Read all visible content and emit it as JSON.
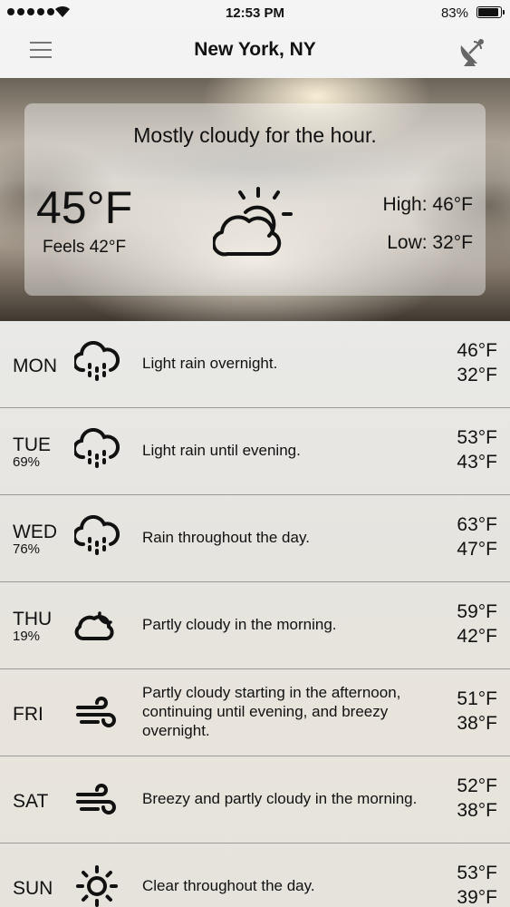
{
  "status_bar": {
    "time": "12:53 PM",
    "battery_pct": "83%",
    "battery_level": 0.83
  },
  "header": {
    "title": "New York, NY",
    "menu_icon": "hamburger-menu-icon",
    "radar_icon": "radar-dish-icon"
  },
  "current": {
    "summary": "Mostly cloudy for the hour.",
    "temp": "45°F",
    "feels_like": "Feels 42°F",
    "high": "High: 46°F",
    "low": "Low: 32°F",
    "icon": "partly-cloudy-day-icon"
  },
  "forecast": [
    {
      "day": "MON",
      "precip": "",
      "icon": "rain-icon",
      "desc": "Light rain overnight.",
      "high": "46°F",
      "low": "32°F"
    },
    {
      "day": "TUE",
      "precip": "69%",
      "icon": "rain-icon",
      "desc": "Light rain until evening.",
      "high": "53°F",
      "low": "43°F"
    },
    {
      "day": "WED",
      "precip": "76%",
      "icon": "rain-icon",
      "desc": "Rain throughout the day.",
      "high": "63°F",
      "low": "47°F"
    },
    {
      "day": "THU",
      "precip": "19%",
      "icon": "partly-cloudy-icon",
      "desc": "Partly cloudy in the morning.",
      "high": "59°F",
      "low": "42°F"
    },
    {
      "day": "FRI",
      "precip": "",
      "icon": "wind-icon",
      "desc": "Partly cloudy starting in the afternoon, continuing until evening, and breezy overnight.",
      "high": "51°F",
      "low": "38°F"
    },
    {
      "day": "SAT",
      "precip": "",
      "icon": "wind-icon",
      "desc": "Breezy and partly cloudy in the morning.",
      "high": "52°F",
      "low": "38°F"
    },
    {
      "day": "SUN",
      "precip": "",
      "icon": "sun-icon",
      "desc": "Clear throughout the day.",
      "high": "53°F",
      "low": "39°F"
    }
  ]
}
